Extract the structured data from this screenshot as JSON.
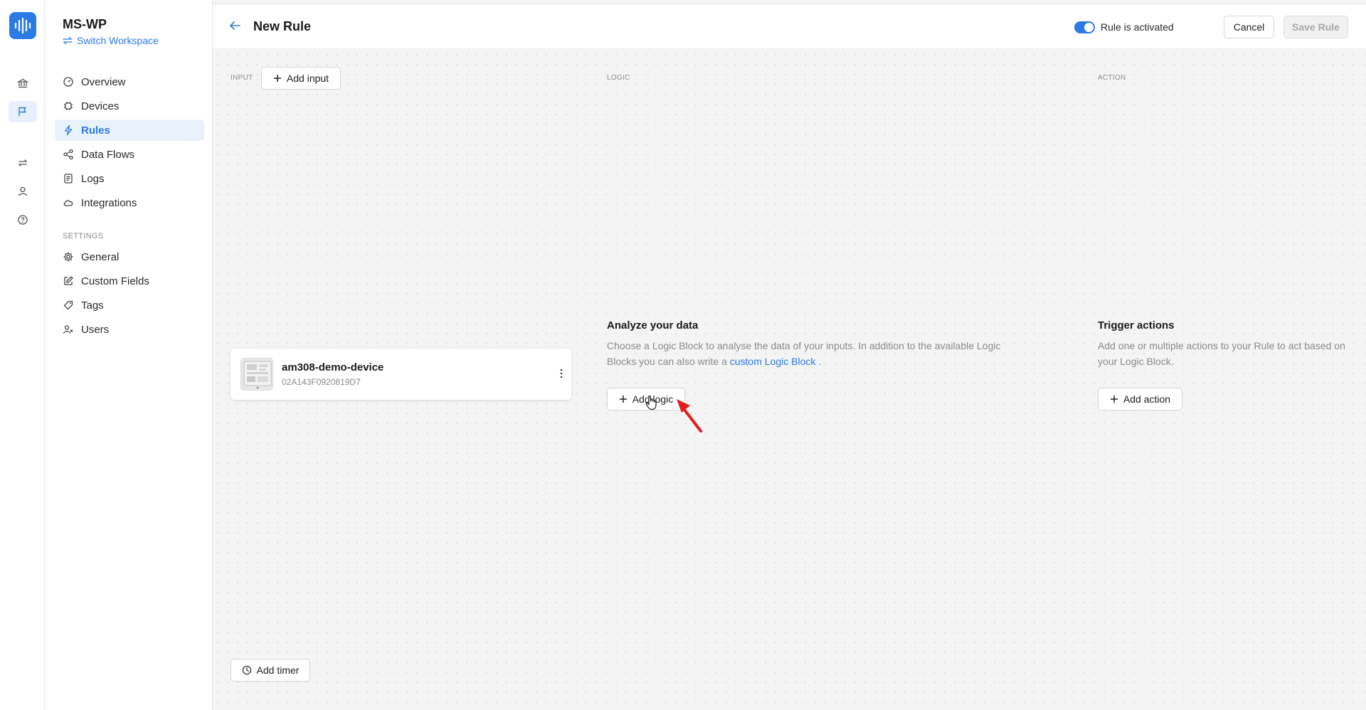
{
  "workspace": {
    "name": "MS-WP",
    "switch_label": "Switch Workspace"
  },
  "nav": [
    {
      "label": "Overview",
      "icon": "gauge-icon",
      "active": false
    },
    {
      "label": "Devices",
      "icon": "chip-icon",
      "active": false
    },
    {
      "label": "Rules",
      "icon": "bolt-icon",
      "active": true
    },
    {
      "label": "Data Flows",
      "icon": "share-icon",
      "active": false
    },
    {
      "label": "Logs",
      "icon": "log-icon",
      "active": false
    },
    {
      "label": "Integrations",
      "icon": "cloud-icon",
      "active": false
    }
  ],
  "settings": {
    "heading": "SETTINGS",
    "items": [
      {
        "label": "General",
        "icon": "gear-icon"
      },
      {
        "label": "Custom Fields",
        "icon": "edit-icon"
      },
      {
        "label": "Tags",
        "icon": "tag-icon"
      },
      {
        "label": "Users",
        "icon": "users-icon"
      }
    ]
  },
  "header": {
    "title": "New Rule",
    "toggle_label": "Rule is activated",
    "toggle_on": true,
    "cancel_label": "Cancel",
    "save_label": "Save Rule"
  },
  "columns": {
    "input": {
      "heading": "INPUT",
      "add_label": "Add input"
    },
    "logic": {
      "heading": "LOGIC",
      "title": "Analyze your data",
      "desc_line1": "Choose a Logic Block to analyse the data of your inputs. In addition to the available Logic",
      "desc_line2_pre": "Blocks you can also write a ",
      "desc_link": "custom Logic Block",
      "desc_line2_post": " .",
      "add_label": "Add logic"
    },
    "action": {
      "heading": "ACTION",
      "title": "Trigger actions",
      "desc_line1": "Add one or multiple actions to your Rule to act based on",
      "desc_line2": "your Logic Block.",
      "add_label": "Add action"
    }
  },
  "device": {
    "name": "am308-demo-device",
    "id": "02A143F0920819D7"
  },
  "timer": {
    "add_label": "Add timer"
  },
  "colors": {
    "accent": "#2b7be5",
    "annotation": "#e11d1d"
  }
}
